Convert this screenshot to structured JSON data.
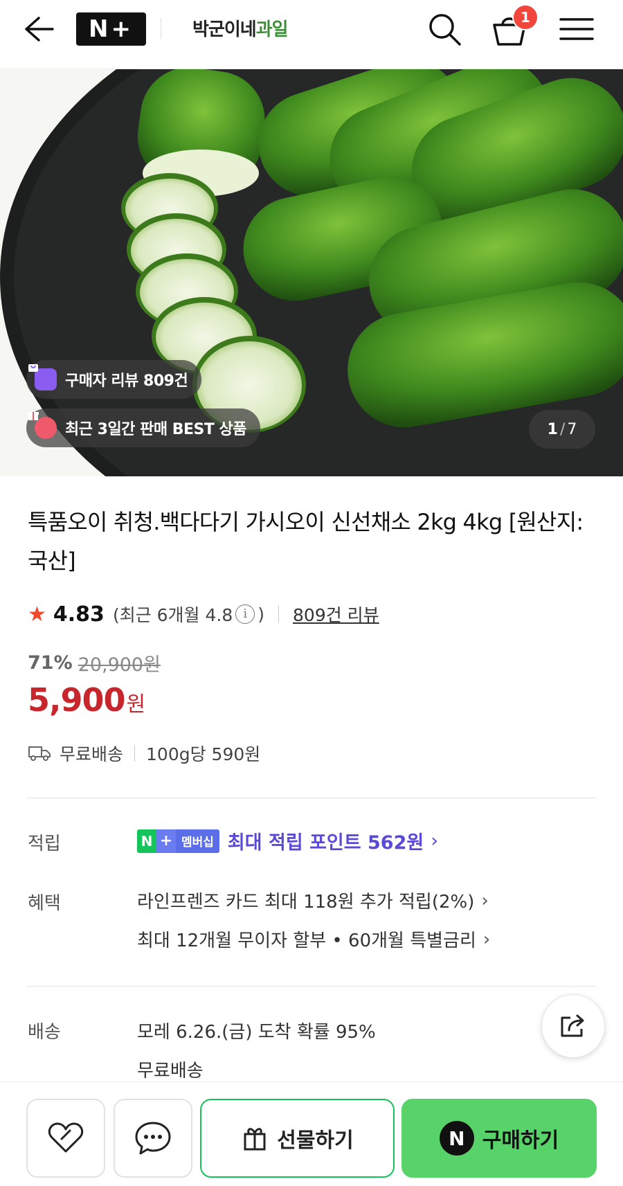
{
  "header": {
    "logo_text": "N+",
    "store_name_part1": "박군이네",
    "store_name_part2": "과일",
    "cart_count": "1"
  },
  "hero": {
    "review_pill": "구매자 리뷰 809건",
    "best_pill": "최근 3일간 판매 BEST 상품",
    "counter_current": "1",
    "counter_sep": "/",
    "counter_total": "7"
  },
  "product": {
    "title": "특품오이 취청.백다다기 가시오이 신선채소 2kg 4kg [원산지:국산]",
    "rating": "4.83",
    "recent_rating_prefix": "(최근 6개월 4.8",
    "recent_rating_suffix": ")",
    "review_link": "809건 리뷰",
    "discount_pct": "71%",
    "original_price": "20,900원",
    "price": "5,900",
    "price_unit": "원",
    "shipping": "무료배송",
    "unit_price": "100g당 590원"
  },
  "points": {
    "label": "적립",
    "badge_n": "N",
    "badge_plus": "+",
    "badge_text": "멤버십",
    "text": "최대 적립 포인트 562원"
  },
  "benefits": {
    "label": "혜택",
    "line1": "라인프렌즈 카드 최대 118원 추가 적립(2%)",
    "line2": "최대 12개월 무이자 할부 • 60개월 특별금리"
  },
  "delivery": {
    "label": "배송",
    "line1": "모레 6.26.(금) 도착 확률 95%",
    "line2": "무료배송"
  },
  "bottom": {
    "gift_label": "선물하기",
    "buy_logo": "N",
    "buy_label": "구매하기"
  },
  "colors": {
    "price_red": "#c8262d",
    "naver_green": "#58d36a",
    "points_purple": "#5a4ad8",
    "badge_red": "#f0463c"
  }
}
